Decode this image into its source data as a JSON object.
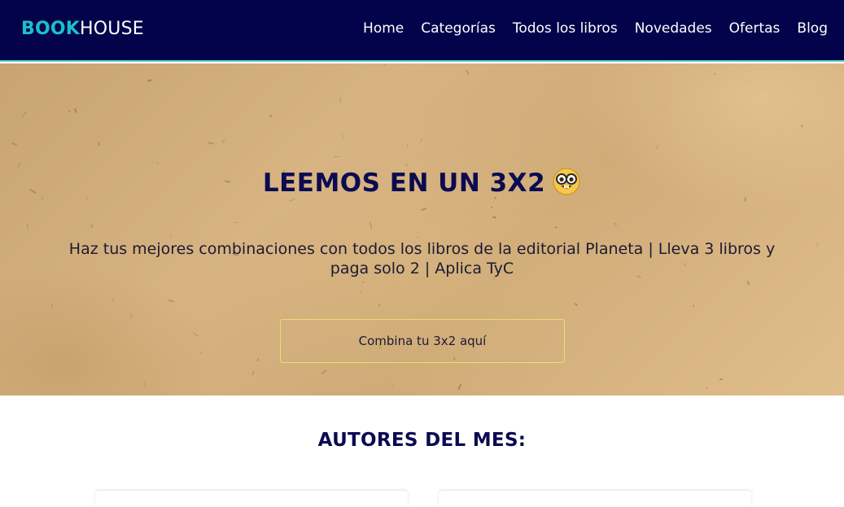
{
  "brand": {
    "part1": "BOOK",
    "part2": "HOUSE"
  },
  "nav": {
    "items": [
      {
        "label": "Home"
      },
      {
        "label": "Categorías"
      },
      {
        "label": "Todos los libros"
      },
      {
        "label": "Novedades"
      },
      {
        "label": "Ofertas"
      },
      {
        "label": "Blog"
      }
    ]
  },
  "hero": {
    "title": "LEEMOS EN UN 3X2",
    "emoji": "nerd-face-icon",
    "text": "Haz tus mejores combinaciones con todos los libros de la editorial Planeta | Lleva 3 libros y paga solo 2 | Aplica TyC",
    "button_label": "Combina tu 3x2 aquí"
  },
  "authors": {
    "title": "AUTORES DEL MES:"
  },
  "colors": {
    "nav_bg": "#02034a",
    "brand_accent": "#19c0c9",
    "title_color": "#0b0a52",
    "button_border": "#f0dc6a"
  }
}
